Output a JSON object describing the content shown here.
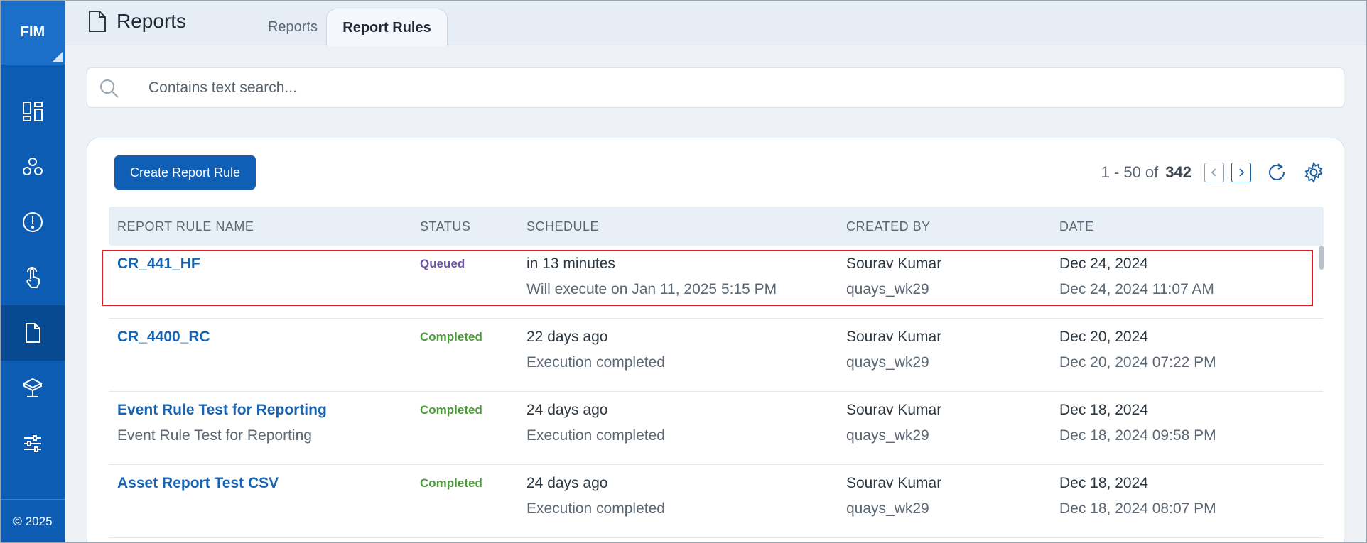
{
  "app": {
    "brand": "FIM",
    "copyright": "© 2025"
  },
  "sidebar": {
    "items": [
      {
        "icon": "dashboard-icon",
        "active": false
      },
      {
        "icon": "cluster-icon",
        "active": false
      },
      {
        "icon": "alert-icon",
        "active": false
      },
      {
        "icon": "touch-icon",
        "active": false
      },
      {
        "icon": "document-icon",
        "active": true
      },
      {
        "icon": "asset-icon",
        "active": false
      },
      {
        "icon": "sliders-icon",
        "active": false
      }
    ]
  },
  "header": {
    "title": "Reports",
    "tabs": [
      {
        "label": "Reports",
        "active": false
      },
      {
        "label": "Report Rules",
        "active": true
      }
    ]
  },
  "search": {
    "placeholder": "Contains text search...",
    "value": ""
  },
  "toolbar": {
    "create_label": "Create Report Rule"
  },
  "pagination": {
    "range": "1 - 50 of",
    "total": "342"
  },
  "table": {
    "headers": [
      "REPORT RULE NAME",
      "STATUS",
      "SCHEDULE",
      "CREATED BY",
      "DATE"
    ],
    "rows": [
      {
        "name": "CR_441_HF",
        "description": "",
        "status": "Queued",
        "schedule": "in 13 minutes",
        "schedule_detail": "Will execute on Jan 11, 2025 5:15 PM",
        "created_by": "Sourav Kumar",
        "created_by_id": "quays_wk29",
        "date": "Dec 24, 2024",
        "datetime": "Dec 24, 2024 11:07 AM"
      },
      {
        "name": "CR_4400_RC",
        "description": "",
        "status": "Completed",
        "schedule": "22 days ago",
        "schedule_detail": "Execution completed",
        "created_by": "Sourav Kumar",
        "created_by_id": "quays_wk29",
        "date": "Dec 20, 2024",
        "datetime": "Dec 20, 2024 07:22 PM"
      },
      {
        "name": "Event Rule Test for Reporting",
        "description": "Event Rule Test for Reporting",
        "status": "Completed",
        "schedule": "24 days ago",
        "schedule_detail": "Execution completed",
        "created_by": "Sourav Kumar",
        "created_by_id": "quays_wk29",
        "date": "Dec 18, 2024",
        "datetime": "Dec 18, 2024 09:58 PM"
      },
      {
        "name": "Asset Report Test CSV",
        "description": "",
        "status": "Completed",
        "schedule": "24 days ago",
        "schedule_detail": "Execution completed",
        "created_by": "Sourav Kumar",
        "created_by_id": "quays_wk29",
        "date": "Dec 18, 2024",
        "datetime": "Dec 18, 2024 08:07 PM"
      }
    ]
  },
  "colors": {
    "sidebar": "#0d5cb3",
    "accent": "#0f5fb6",
    "queued": "#6a55a6",
    "completed": "#4c9b3a",
    "highlight": "#e01b24"
  }
}
